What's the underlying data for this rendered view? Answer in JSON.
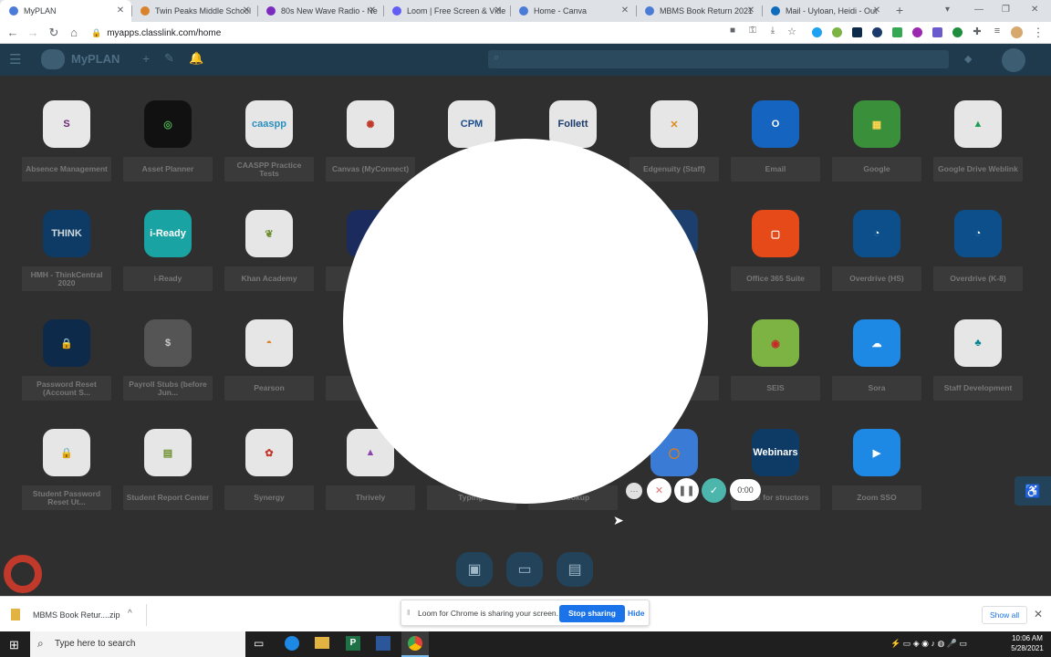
{
  "tabs": [
    {
      "title": "MyPLAN",
      "fav": "#4a7bd6",
      "active": true
    },
    {
      "title": "Twin Peaks Middle School",
      "fav": "#d9822b",
      "active": false
    },
    {
      "title": "80s New Wave Radio - Ne",
      "fav": "#7b2cbf",
      "active": false
    },
    {
      "title": "Loom | Free Screen & Vide",
      "fav": "#625df5",
      "active": false
    },
    {
      "title": "Home - Canva",
      "fav": "#4a7bd6",
      "active": false
    },
    {
      "title": "MBMS Book Return 2021",
      "fav": "#4a7bd6",
      "active": false
    },
    {
      "title": "Mail - Uyloan, Heidi - Out",
      "fav": "#0f6cbd",
      "active": false
    }
  ],
  "toolbar": {
    "url": "myapps.classlink.com/home"
  },
  "app": {
    "logo": "MyPLAN"
  },
  "apps": [
    {
      "label": "Absence Management",
      "color": "#e8e8e8",
      "glyph": "S",
      "gcolor": "#6b2a73"
    },
    {
      "label": "Asset Planner",
      "color": "#111111",
      "glyph": "◎",
      "gcolor": "#4caf50"
    },
    {
      "label": "CAASPP Practice Tests",
      "color": "#e6e6e6",
      "glyph": "caaspp",
      "gcolor": "#2a8fbf"
    },
    {
      "label": "Canvas (MyConnect)",
      "color": "#e6e6e6",
      "glyph": "✺",
      "gcolor": "#c0392b"
    },
    {
      "label": "",
      "color": "#e6e6e6",
      "glyph": "CPM",
      "gcolor": "#1b4d8a"
    },
    {
      "label": "",
      "color": "#e6e6e6",
      "glyph": "Follett",
      "gcolor": "#1b3a6b"
    },
    {
      "label": "Edgenuity (Staff)",
      "color": "#e6e6e6",
      "glyph": "✕",
      "gcolor": "#e08a1e"
    },
    {
      "label": "Email",
      "color": "#1565c0",
      "glyph": "O",
      "gcolor": "#ffffff"
    },
    {
      "label": "Google",
      "color": "#3a8f3a",
      "glyph": "▦",
      "gcolor": "#ffd54f"
    },
    {
      "label": "Google Drive Weblink",
      "color": "#e6e6e6",
      "glyph": "▲",
      "gcolor": "#1e9e54"
    },
    {
      "label": "HMH - ThinkCentral 2020",
      "color": "#0d3b66",
      "glyph": "THINK",
      "gcolor": "#cfd8dc"
    },
    {
      "label": "i-Ready",
      "color": "#1aa3a3",
      "glyph": "i-Ready",
      "gcolor": "#ffffff"
    },
    {
      "label": "Khan Academy",
      "color": "#e6e6e6",
      "glyph": "❦",
      "gcolor": "#6d8f2f"
    },
    {
      "label": "Le",
      "color": "#1c2b5e",
      "glyph": "",
      "gcolor": "#ffffff"
    },
    {
      "label": "",
      "color": "#2f2f2f",
      "glyph": "",
      "gcolor": "#ffffff"
    },
    {
      "label": "",
      "color": "#2f2f2f",
      "glyph": "",
      "gcolor": "#ffffff"
    },
    {
      "label": "",
      "color": "#1c3f6e",
      "glyph": "",
      "gcolor": "#ffffff"
    },
    {
      "label": "Office 365 Suite",
      "color": "#e64a19",
      "glyph": "▢",
      "gcolor": "#ffffff"
    },
    {
      "label": "Overdrive (HS)",
      "color": "#0d4f8b",
      "glyph": "◔",
      "gcolor": "#ffffff"
    },
    {
      "label": "Overdrive (K-8)",
      "color": "#0d4f8b",
      "glyph": "◔",
      "gcolor": "#ffffff"
    },
    {
      "label": "Password Reset (Account S...",
      "color": "#0d2a4a",
      "glyph": "🔒",
      "gcolor": "#ffffff"
    },
    {
      "label": "Payroll Stubs (before Jun...",
      "color": "#555555",
      "glyph": "$",
      "gcolor": "#cccccc"
    },
    {
      "label": "Pearson",
      "color": "#e6e6e6",
      "glyph": "◓",
      "gcolor": "#e07a1e"
    },
    {
      "label": "Pe",
      "color": "#2f2f2f",
      "glyph": "",
      "gcolor": "#ffffff"
    },
    {
      "label": "",
      "color": "#2f2f2f",
      "glyph": "",
      "gcolor": "#ffffff"
    },
    {
      "label": "",
      "color": "#2f2f2f",
      "glyph": "",
      "gcolor": "#ffffff"
    },
    {
      "label": "e",
      "color": "#2f2f2f",
      "glyph": "",
      "gcolor": "#ffffff"
    },
    {
      "label": "SEIS",
      "color": "#7cb342",
      "glyph": "◉",
      "gcolor": "#c62828"
    },
    {
      "label": "Sora",
      "color": "#1e88e5",
      "glyph": "☁",
      "gcolor": "#ffffff"
    },
    {
      "label": "Staff Development",
      "color": "#e6e6e6",
      "glyph": "♣",
      "gcolor": "#00838f"
    },
    {
      "label": "Student Password Reset Ut...",
      "color": "#e6e6e6",
      "glyph": "🔒",
      "gcolor": "#6b2a73"
    },
    {
      "label": "Student Report Center",
      "color": "#e6e6e6",
      "glyph": "▤",
      "gcolor": "#6d8f2f"
    },
    {
      "label": "Synergy",
      "color": "#e6e6e6",
      "glyph": "✿",
      "gcolor": "#c0392b"
    },
    {
      "label": "Thrively",
      "color": "#e6e6e6",
      "glyph": "▲",
      "gcolor": "#8e44ad"
    },
    {
      "label": "Typing.",
      "color": "#2f2f2f",
      "glyph": "",
      "gcolor": "#ffffff"
    },
    {
      "label": "r Lookup",
      "color": "#2f2f2f",
      "glyph": "",
      "gcolor": "#ffffff"
    },
    {
      "label": "",
      "color": "#3a7bd5",
      "glyph": "◯",
      "gcolor": "#f57c00"
    },
    {
      "label": "inars for structors",
      "color": "#0d3b66",
      "glyph": "Webinars",
      "gcolor": "#ffffff"
    },
    {
      "label": "Zoom SSO",
      "color": "#1e88e5",
      "glyph": "▶",
      "gcolor": "#ffffff"
    }
  ],
  "loom": {
    "timer": "0:00"
  },
  "download": {
    "filename": "MBMS Book Retur....zip",
    "share_msg": "Loom for Chrome is sharing your screen.",
    "stop_label": "Stop sharing",
    "hide_label": "Hide",
    "show_all": "Show all"
  },
  "taskbar": {
    "search_placeholder": "Type here to search",
    "time": "10:06 AM",
    "date": "5/28/2021"
  }
}
